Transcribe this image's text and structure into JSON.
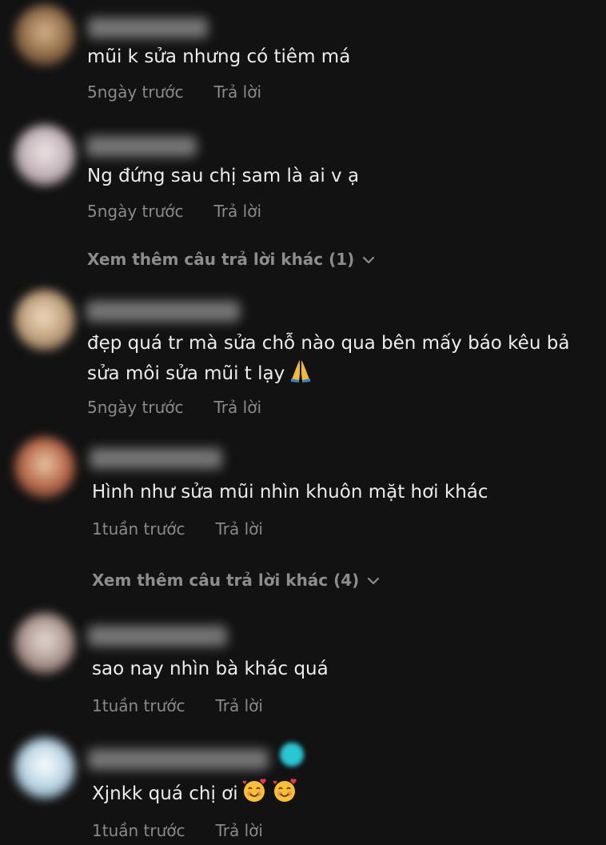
{
  "comments": [
    {
      "text": "mũi k sửa nhưng có tiêm má",
      "time": "5ngày trước",
      "reply": "Trả lời",
      "avatar_color": "#a27a52"
    },
    {
      "text": "Ng đứng sau chị sam là ai v ạ",
      "time": "5ngày trước",
      "reply": "Trả lời",
      "avatar_color": "#c9c1c4"
    },
    {
      "text_line1": "đẹp quá tr mà sửa chỗ nào qua bên mấy báo kêu bả",
      "text_line2": "sửa môi sửa mũi t lạy",
      "emoji": "folded-hands",
      "time": "5ngày trước",
      "reply": "Trả lời",
      "avatar_color": "#c7b192"
    },
    {
      "text": "Hình như sửa mũi nhìn khuôn mặt hơi khác",
      "time": "1tuần trước",
      "reply": "Trả lời",
      "avatar_color": "#c89a78"
    },
    {
      "text": "sao nay nhìn bà khác quá",
      "time": "1tuần trước",
      "reply": "Trả lời",
      "avatar_color": "#c2b7b3"
    },
    {
      "text": "Xjnkk quá chị ơi",
      "emoji": "smiling-face-with-hearts",
      "time": "1tuần trước",
      "reply": "Trả lời",
      "avatar_color": "#a9c8da"
    }
  ],
  "more_replies": [
    {
      "label": "Xem thêm câu trả lời khác (1)"
    },
    {
      "label": "Xem thêm câu trả lời khác (4)"
    }
  ]
}
